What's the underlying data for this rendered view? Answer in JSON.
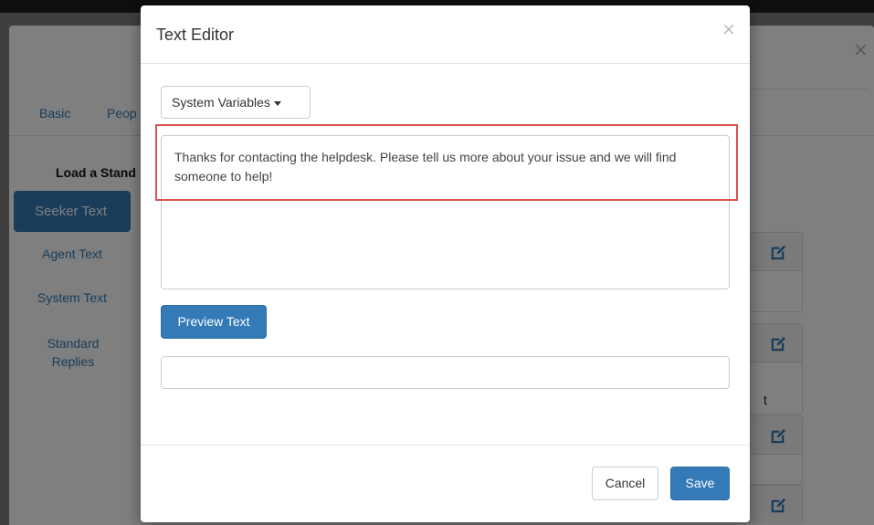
{
  "background": {
    "tabs": [
      "Basic",
      "Peop"
    ],
    "load_label": "Load a Stand",
    "pills": [
      "Seeker Text",
      "Agent Text",
      "System Text",
      "Standard Replies"
    ],
    "card_fragment": "t",
    "close_glyph": "×"
  },
  "modal": {
    "title": "Text Editor",
    "close_glyph": "×",
    "variables_button": "System Variables",
    "text_value": "Thanks for contacting the helpdesk. Please tell us more about your issue and we will find someone to help!",
    "preview_button": "Preview Text",
    "preview_output": "",
    "cancel_button": "Cancel",
    "save_button": "Save"
  },
  "colors": {
    "primary": "#337ab7",
    "highlight": "#d9534f"
  },
  "icons": {
    "card_edit": "edit-icon"
  }
}
